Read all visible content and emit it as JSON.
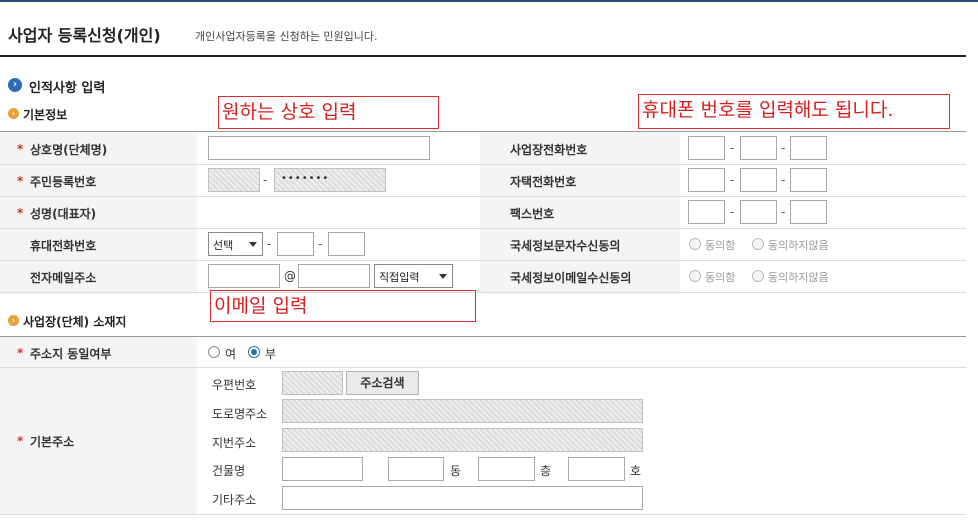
{
  "page": {
    "title": "사업자 등록신청(개인)",
    "subtitle": "개인사업자등록을 신청하는 민원입니다."
  },
  "section_personal": {
    "title": "인적사항 입력",
    "basic_info": "기본정보",
    "labels": {
      "trade_name": "상호명(단체명)",
      "resident_no": "주민등록번호",
      "representative": "성명(대표자)",
      "mobile": "휴대전화번호",
      "email": "전자메일주소",
      "biz_phone": "사업장전화번호",
      "home_phone": "자택전화번호",
      "fax": "팩스번호",
      "sms_consent": "국세정보문자수신동의",
      "email_consent": "국세정보이메일수신동의"
    },
    "resident_mask": "•••••••",
    "mobile_select": "선택",
    "email_at": "@",
    "email_select": "직접입력",
    "consent_agree": "동의함",
    "consent_disagree": "동의하지않음",
    "dash": "-"
  },
  "section_address": {
    "title": "사업장(단체) 소재지",
    "same_address_label": "주소지 동일여부",
    "yes": "여",
    "no": "부",
    "basic_address_label": "기본주소",
    "postal": "우편번호",
    "search_button": "주소검색",
    "road_address": "도로명주소",
    "lot_address": "지번주소",
    "building": "건물명",
    "dong": "동",
    "floor": "층",
    "ho": "호",
    "other_address": "기타주소"
  },
  "annotations": {
    "trade_name_note": "원하는 상호 입력",
    "phone_note": "휴대폰 번호를 입력해도 됩니다.",
    "email_note": "이메일 입력"
  },
  "colors": {
    "accent_blue": "#2d6db5",
    "required_red": "#c0392b",
    "annotation_red": "#d81f1f",
    "sub_icon_orange": "#e8a23a"
  }
}
